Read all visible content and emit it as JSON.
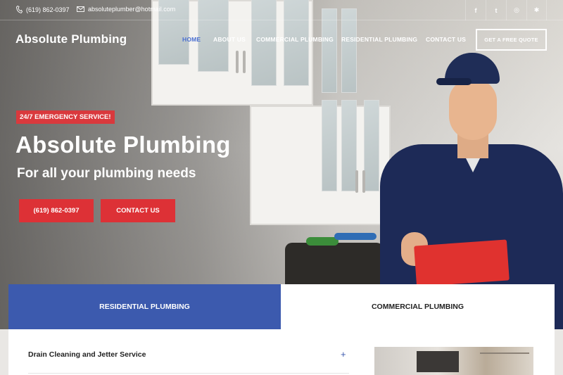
{
  "topbar": {
    "phone": "(619) 862-0397",
    "email": "absoluteplumber@hotmail.com",
    "social": [
      {
        "icon": "facebook-icon",
        "glyph": "f"
      },
      {
        "icon": "twitter-icon",
        "glyph": "t"
      },
      {
        "icon": "instagram-icon",
        "glyph": "◎"
      },
      {
        "icon": "yelp-icon",
        "glyph": "✱"
      }
    ]
  },
  "header": {
    "logo": "Absolute Plumbing",
    "nav": [
      "HOME",
      "ABOUT US",
      "COMMERCIAL PLUMBING",
      "RESIDENTIAL PLUMBING",
      "CONTACT US"
    ],
    "active_nav": "HOME",
    "quote_button": "GET A FREE QUOTE"
  },
  "hero": {
    "badge": "24/7 EMERGENCY SERVICE!",
    "title": "Absolute Plumbing",
    "subtitle": "For all your plumbing needs",
    "phone_button": "(619) 862-0397",
    "contact_button": "CONTACT US"
  },
  "tabs": {
    "residential": "RESIDENTIAL PLUMBING",
    "commercial": "COMMERCIAL PLUMBING"
  },
  "content": {
    "accordion_item": "Drain Cleaning and Jetter Service",
    "accordion_toggle": "+"
  },
  "colors": {
    "accent_red": "#dd3136",
    "accent_blue": "#3c5aae",
    "nav_active": "#4a6fd1"
  }
}
